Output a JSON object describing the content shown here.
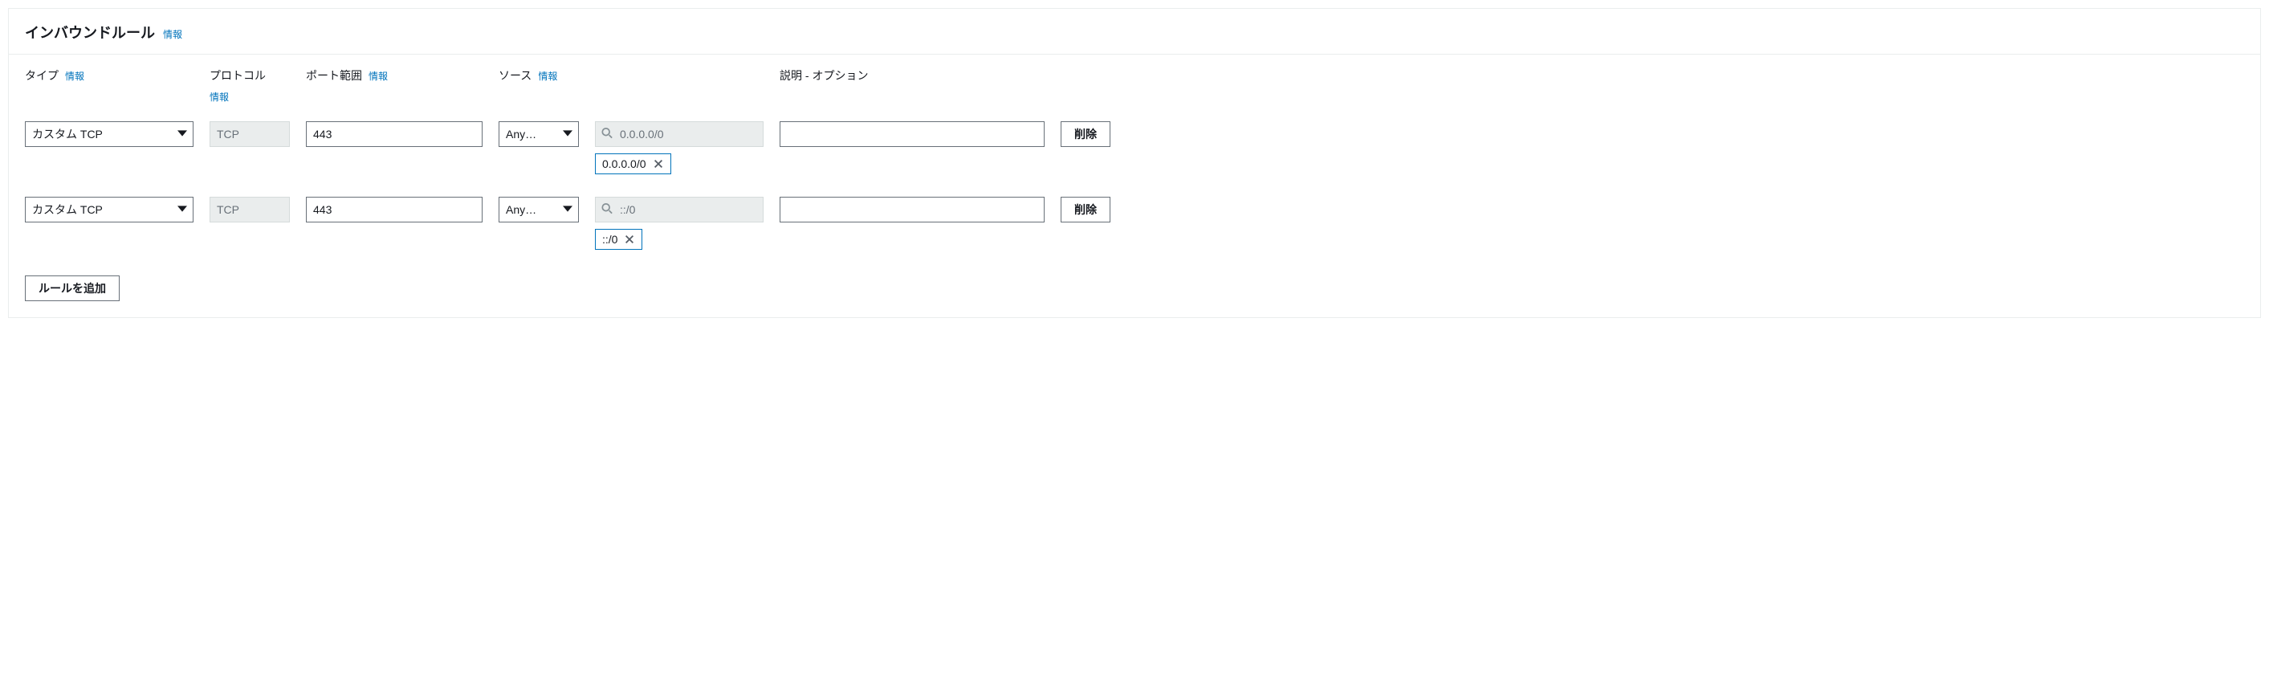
{
  "header": {
    "title": "インバウンドルール",
    "info": "情報"
  },
  "columns": {
    "type": {
      "label": "タイプ",
      "info": "情報"
    },
    "protocol": {
      "label": "プロトコル",
      "info": "情報"
    },
    "port": {
      "label": "ポート範囲",
      "info": "情報"
    },
    "source": {
      "label": "ソース",
      "info": "情報"
    },
    "description": {
      "label": "説明 - オプション"
    }
  },
  "rules": [
    {
      "type": "カスタム TCP",
      "protocol": "TCP",
      "port": "443",
      "source_select": "Any…",
      "source_placeholder": "0.0.0.0/0",
      "source_tag": "0.0.0.0/0",
      "description": "",
      "delete": "削除"
    },
    {
      "type": "カスタム TCP",
      "protocol": "TCP",
      "port": "443",
      "source_select": "Any…",
      "source_placeholder": "::/0",
      "source_tag": "::/0",
      "description": "",
      "delete": "削除"
    }
  ],
  "add_rule": "ルールを追加"
}
